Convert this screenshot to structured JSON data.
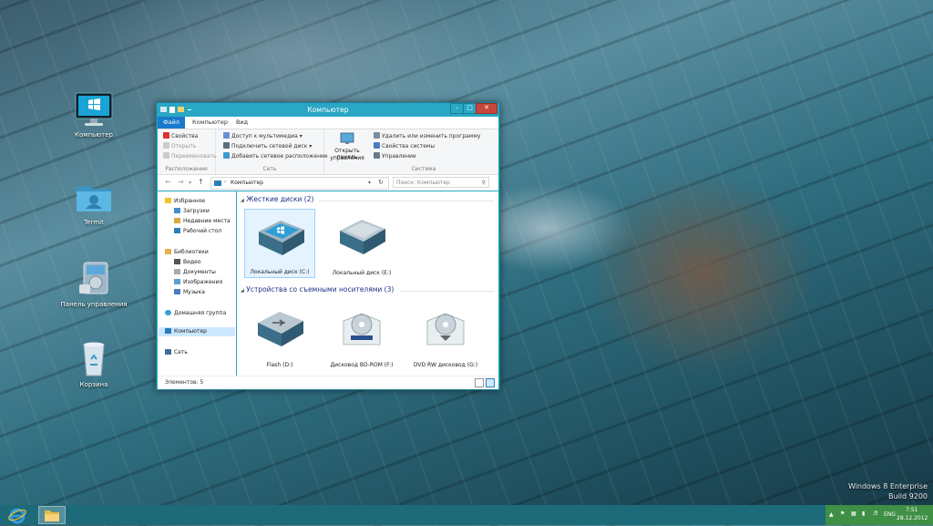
{
  "desktop": {
    "icons": [
      {
        "label": "Компьютер"
      },
      {
        "label": "Termit"
      },
      {
        "label": "Панель управления"
      },
      {
        "label": "Корзина"
      }
    ],
    "watermark": {
      "line1": "Windows 8 Enterprise",
      "line2": "Build 9200"
    }
  },
  "window": {
    "title": "Компьютер",
    "ribbon_tabs": [
      "Файл",
      "Компьютер",
      "Вид"
    ],
    "ribbon": {
      "location": {
        "items": [
          "Свойства",
          "Открыть",
          "Переименовать"
        ],
        "label": "Расположение"
      },
      "network": {
        "items": [
          "Доступ к мультимедиа",
          "Подключить сетевой диск",
          "Добавить сетевое расположение"
        ],
        "label": "Сеть"
      },
      "open_panel": {
        "line1": "Открыть панель",
        "line2": "управления"
      },
      "system": {
        "items": [
          "Удалить или изменить программу",
          "Свойства системы",
          "Управление"
        ],
        "label": "Система"
      }
    },
    "address": {
      "path": "Компьютер",
      "search_placeholder": "Поиск: Компьютер"
    },
    "nav": {
      "favorites": "Избранное",
      "favorites_items": [
        "Загрузки",
        "Недавние места",
        "Рабочий стол"
      ],
      "libraries": "Библиотеки",
      "libraries_items": [
        "Видео",
        "Документы",
        "Изображения",
        "Музыка"
      ],
      "homegroup": "Домашняя группа",
      "computer": "Компьютер",
      "network": "Сеть"
    },
    "sections": {
      "hdd": {
        "title": "Жесткие диски (2)",
        "items": [
          "Локальный диск (C:)",
          "Локальный диск (E:)"
        ]
      },
      "removable": {
        "title": "Устройства со съемными носителями (3)",
        "items": [
          "Flash (D:)",
          "Дисковод BD-ROM (F:)",
          "DVD RW дисковод (G:)"
        ]
      }
    },
    "status": "Элементов: 5"
  },
  "taskbar": {
    "tray": {
      "lang": "ENG",
      "time": "7:51",
      "date": "28.12.2012"
    }
  },
  "colors": {
    "accent": "#29a7c4",
    "taskbar": "#1d6a78",
    "tray": "#3f8f44",
    "file_tab": "#1979ca"
  }
}
